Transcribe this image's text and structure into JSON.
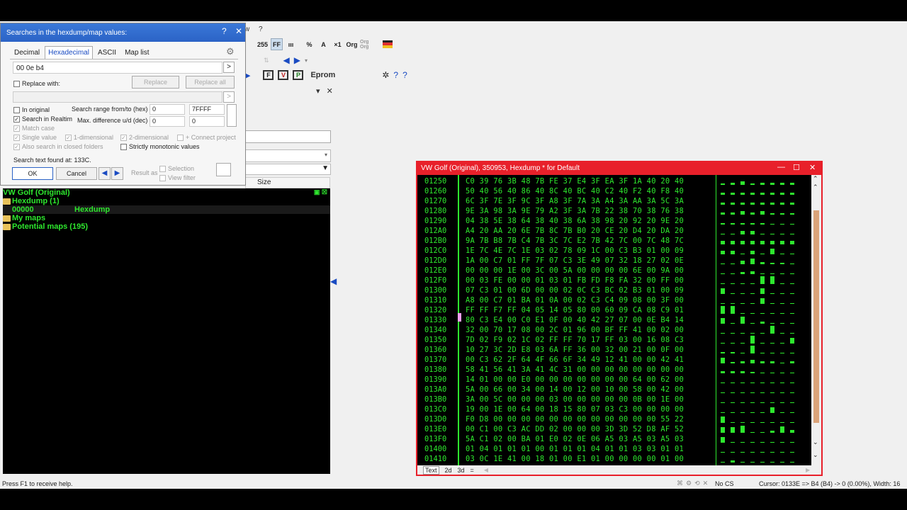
{
  "menu": {
    "items": [
      "w",
      "?"
    ]
  },
  "toolbar": {
    "buttons": [
      "255",
      "FF",
      "ııı",
      "%",
      "A",
      "×1",
      "Org",
      "Org Org"
    ],
    "eprom_label": "Eprom"
  },
  "dialog": {
    "title": "Searches in the hexdump/map values:",
    "help_glyph": "?",
    "close_glyph": "✕",
    "tabs": [
      "Decimal",
      "Hexadecimal",
      "ASCII",
      "Map list"
    ],
    "active_tab": "Hexadecimal",
    "search_value": "00 0e b4",
    "replace_with_label": "Replace with:",
    "replace_button": "Replace",
    "replace_all_button": "Replace all",
    "in_original_label": "In original",
    "search_realtime_label": "Search in Realtim",
    "match_case_label": "Match case",
    "single_value_label": "Single value",
    "one_dim_label": "1-dimensional",
    "two_dim_label": "2-dimensional",
    "connect_project_label": "+ Connect project",
    "closed_folders_label": "Also search in closed folders",
    "monotonic_label": "Strictly monotonic values",
    "search_range_label": "Search range from/to (hex)",
    "range_from": "0",
    "range_to": "7FFFF",
    "max_diff_label": "Max. difference u/d (dec)",
    "diff_up": "0",
    "diff_down": "0",
    "found_text": "Search text found at: 133C.",
    "ok_button": "OK",
    "cancel_button": "Cancel",
    "result_as_label": "Result as",
    "selection_label": "Selection",
    "view_filter_label": "View filter",
    "arrow_glyph": ">"
  },
  "project": {
    "size_header": "Size",
    "tree": [
      {
        "label": "VW Golf (Original)",
        "col2": ""
      },
      {
        "label": "Hexdump (1)",
        "col2": ""
      },
      {
        "label": "00000",
        "col2": "Hexdump"
      },
      {
        "label": "My maps",
        "col2": ""
      },
      {
        "label": "Potential maps (195)",
        "col2": ""
      }
    ]
  },
  "hexdump": {
    "title": "VW Golf (Original), 350953, Hexdump * for Default",
    "addresses": "01250\n01260\n01270\n01280\n01290\n012A0\n012B0\n012C0\n012D0\n012E0\n012F0\n01300\n01310\n01320\n01330\n01340\n01350\n01360\n01370\n01380\n01390\n013A0\n013B0\n013C0\n013D0\n013E0\n013F0\n01400\n01410",
    "bytes": "C0 39 76 3B 48 7B FE 37 E4 3F EA 3F 1A 40 20 40\n50 40 56 40 86 40 8C 40 BC 40 C2 40 F2 40 F8 40\n6C 3F 7E 3F 9C 3F A8 3F 7A 3A A4 3A AA 3A 5C 3A\n9E 3A 98 3A 9E 79 A2 3F 3A 7B 22 38 70 38 76 38\n04 38 5E 38 64 38 40 38 6A 38 98 20 92 20 9E 20\nA4 20 AA 20 6E 7B 8C 7B B0 20 CE 20 D4 20 DA 20\n9A 7B B8 7B C4 7B 3C 7C E2 7B 42 7C 00 7C 48 7C\n1E 7C 4E 7C 1E 03 02 78 09 1C 00 C3 B3 01 00 09\n1A 00 C7 01 FF 7F 07 C3 3E 49 07 32 18 27 02 0E\n00 00 00 1E 00 3C 00 5A 00 00 00 00 6E 00 9A 00\n00 03 FE 00 00 01 03 01 FB FD F8 FA 32 00 FF 00\n07 C3 01 00 6D 00 00 02 0C C3 BC 02 B3 01 00 09\nA8 00 C7 01 BA 01 0A 00 02 C3 C4 09 08 00 3F 00\nFF FF F7 FF 04 05 14 05 80 00 60 09 CA 08 C9 01\n80 C3 E4 00 C0 E1 0F 00 40 42 27 07 00 0E B4 14\n32 00 70 17 08 00 2C 01 96 00 BF FF 41 00 02 00\n7D 02 F9 02 1C 02 FF FF 70 17 FF 03 00 16 08 C3\n10 27 3C 2D E8 03 6A FF 36 00 32 00 21 00 0F 00\n00 C3 62 2F 64 4F 66 6F 34 49 12 41 00 00 42 41\n58 41 56 41 3A 41 4C 31 00 00 00 00 00 00 00 00\n14 01 00 00 E0 00 00 00 00 00 00 00 64 00 62 00\n5A 00 66 00 34 00 14 00 12 00 10 00 58 00 42 00\n3A 00 5C 00 00 00 03 00 00 00 00 00 0B 00 1E 00\n19 00 1E 00 64 00 18 15 80 07 03 C3 00 00 00 00\nF0 D8 00 00 00 00 00 00 00 00 00 00 00 00 55 22\n00 C1 00 C3 AC DD 02 00 00 00 3D 3D 52 D8 AF 52\n5A C1 02 00 BA 01 E0 02 0E 06 A5 03 A5 03 A5 03\n01 04 01 01 01 00 01 01 01 04 01 01 03 03 01 01\n03 0C 1E 41 00 18 01 00 E1 01 00 00 00 00 01 00",
    "tabs": [
      "Text",
      "2d",
      "3d",
      "="
    ]
  },
  "status": {
    "help": "Press F1 to receive help.",
    "checksum": "No CS",
    "cursor": "Cursor: 0133E => B4 (B4) ->  0 (0.00%), Width: 16"
  },
  "colors": {
    "hex_green": "#2ee82e",
    "window_red": "#e8202a",
    "title_blue": "#2b63c6"
  }
}
